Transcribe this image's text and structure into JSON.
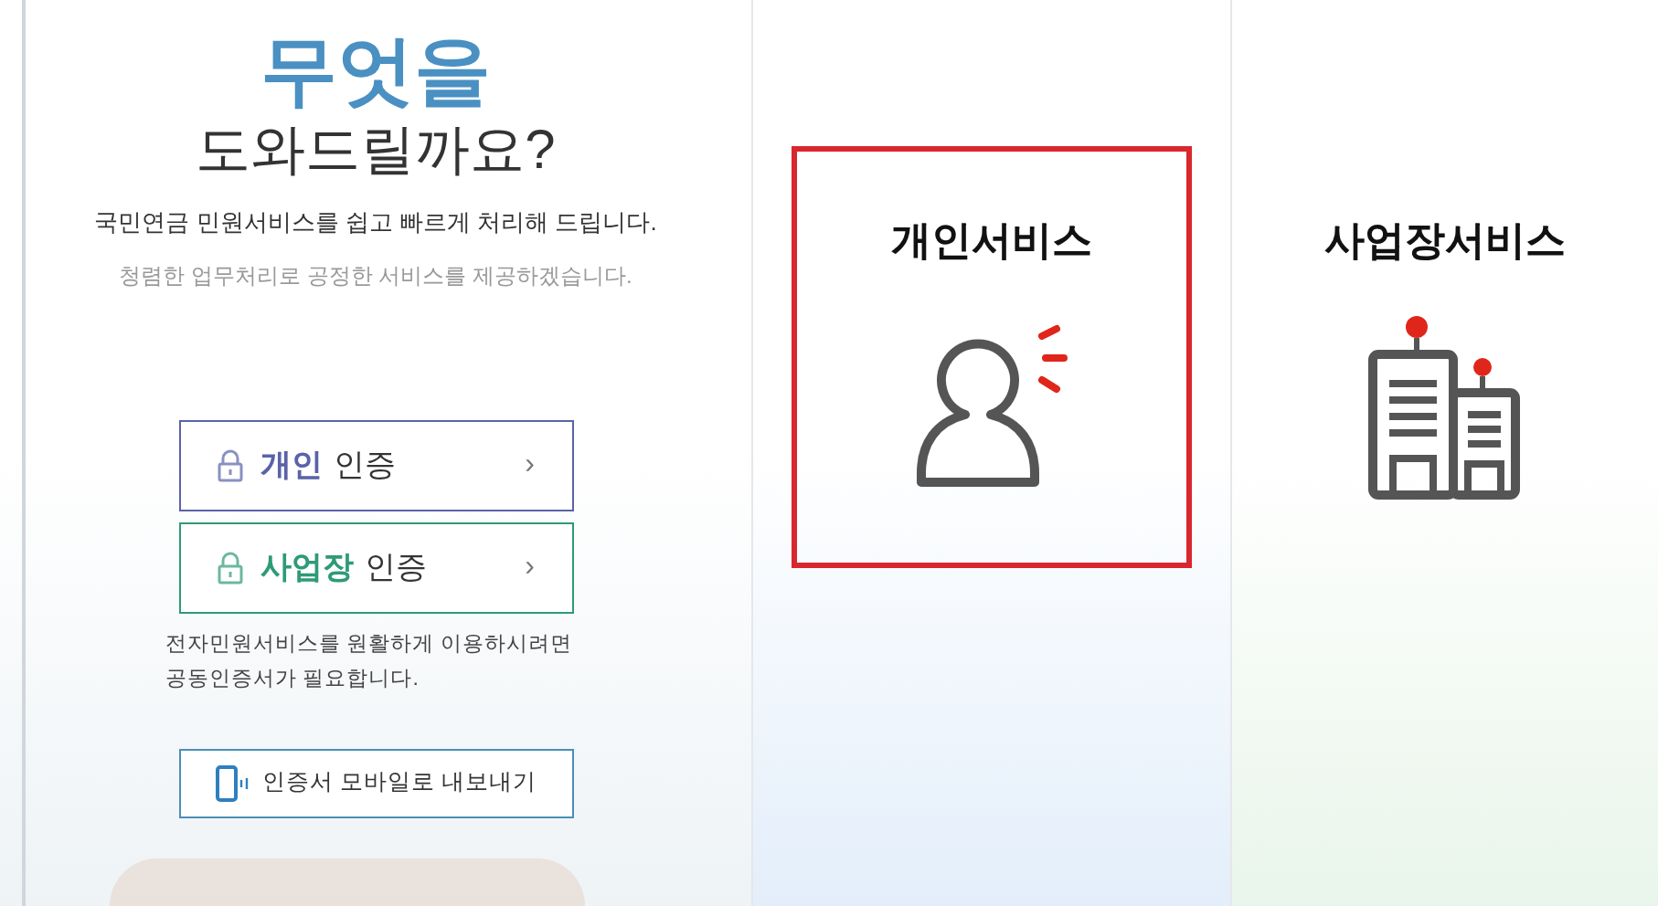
{
  "intro": {
    "title_accent": "무엇을",
    "title": "도와드릴까요?",
    "subtitle": "국민연금 민원서비스를 쉽고 빠르게 처리해 드립니다.",
    "tagline": "청렴한 업무처리로 공정한 서비스를 제공하겠습니다."
  },
  "auth_buttons": [
    {
      "accent": "개인",
      "label": "인증",
      "arrow": "›",
      "color": "#5a63a8"
    },
    {
      "accent": "사업장",
      "label": "인증",
      "arrow": "›",
      "color": "#2e9a78"
    }
  ],
  "auth_note": "전자민원서비스를 원활하게 이용하시려면 공동인증서가 필요합니다.",
  "mobile_button": "인증서 모바일로 내보내기",
  "services": [
    {
      "kind": "person",
      "label": "개인서비스",
      "selected": true
    },
    {
      "kind": "building",
      "label": "사업장서비스",
      "selected": false
    }
  ]
}
